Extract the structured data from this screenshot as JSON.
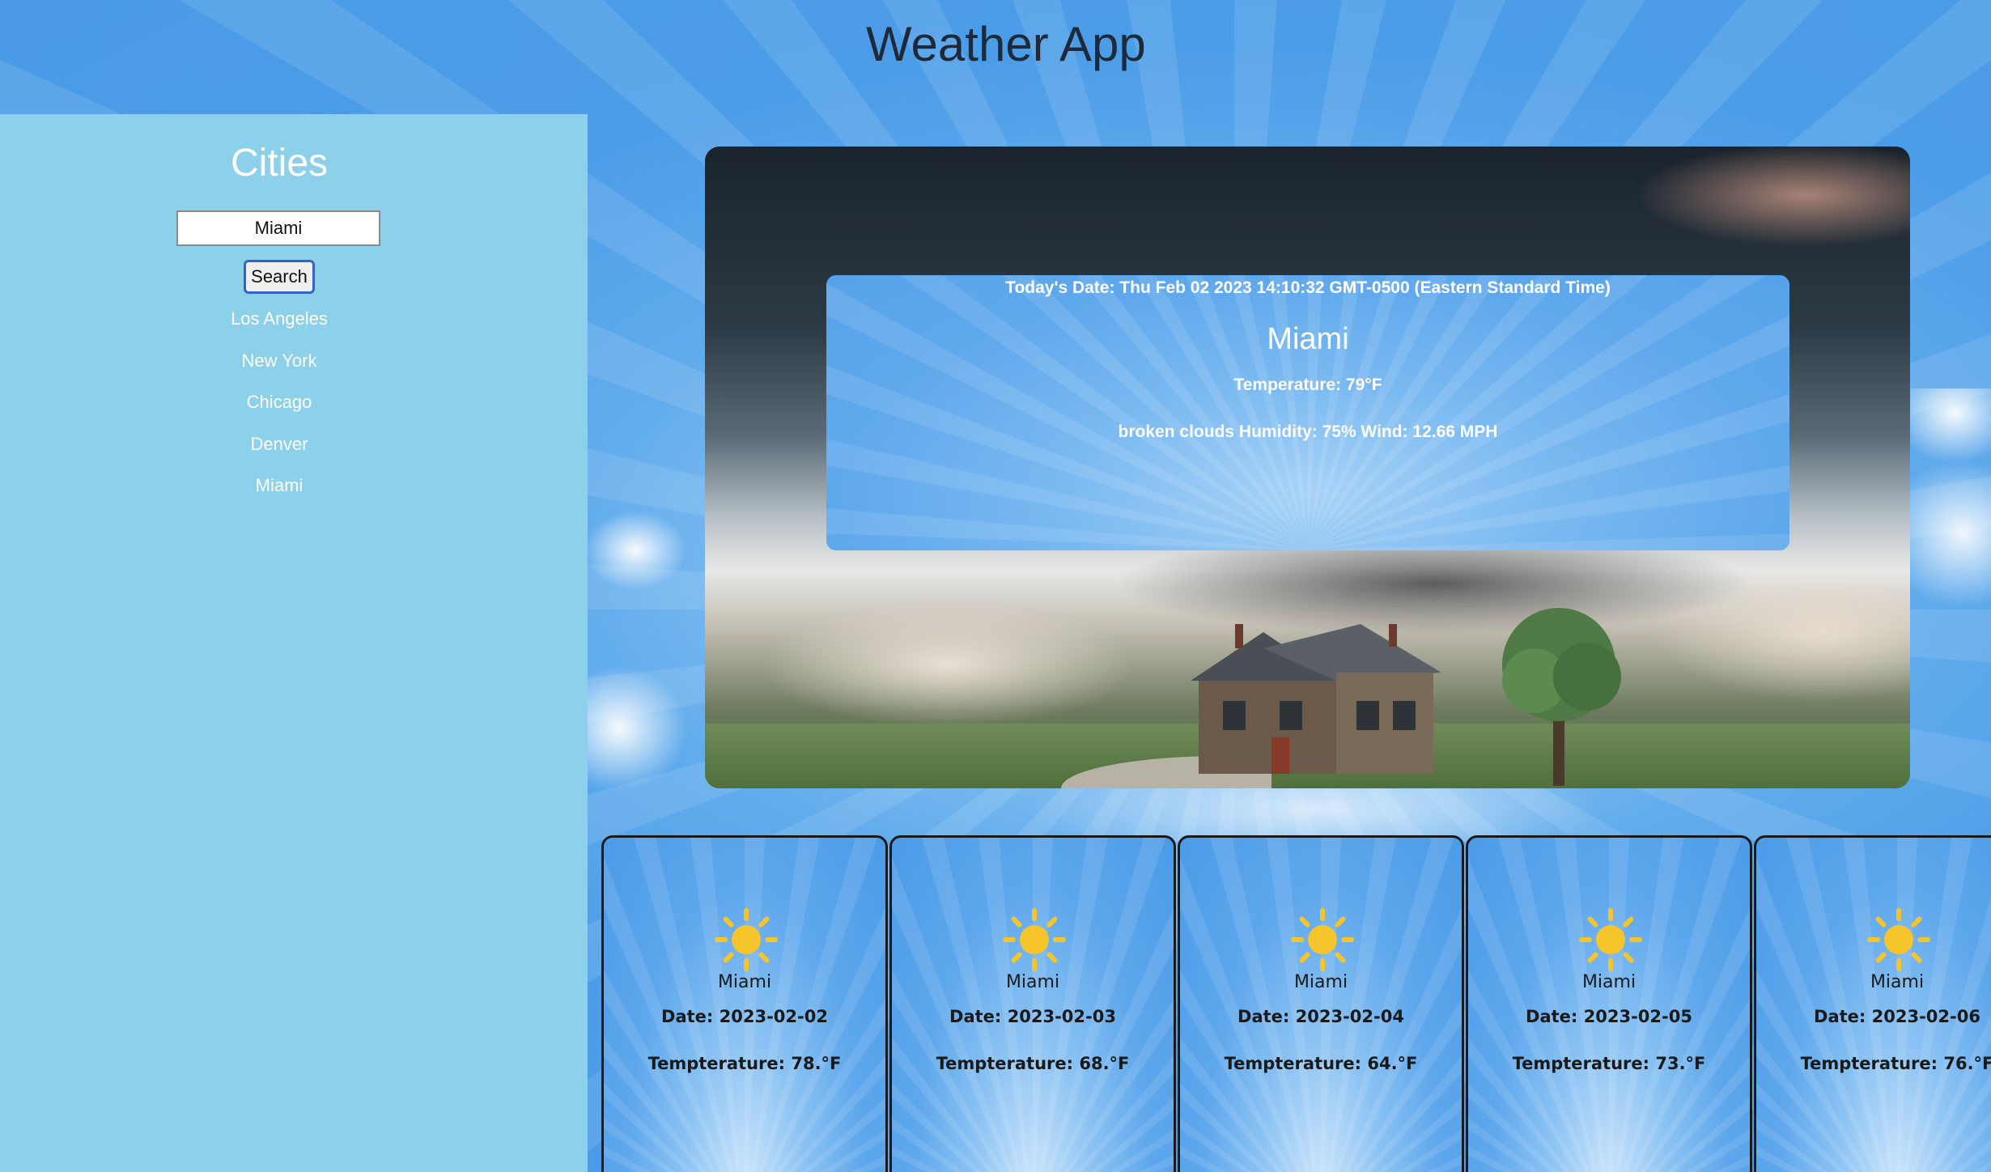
{
  "header": {
    "title": "Weather App"
  },
  "sidebar": {
    "title": "Cities",
    "search": {
      "value": "Miami",
      "button_label": "Search"
    },
    "cities": [
      {
        "label": "Los Angeles"
      },
      {
        "label": "New York"
      },
      {
        "label": "Chicago"
      },
      {
        "label": "Denver"
      },
      {
        "label": "Miami"
      }
    ]
  },
  "today": {
    "date_text": "Today's Date: Thu Feb 02 2023 14:10:32 GMT-0500 (Eastern Standard Time)",
    "city": "Miami",
    "temperature_text": "Temperature: 79°F",
    "details_text": "broken clouds Humidity: 75% Wind: 12.66 MPH"
  },
  "forecast": [
    {
      "icon": "sun-icon",
      "city": "Miami",
      "date_text": "Date: 2023-02-02",
      "temp_text": "Tempterature: 78.°F"
    },
    {
      "icon": "sun-icon",
      "city": "Miami",
      "date_text": "Date: 2023-02-03",
      "temp_text": "Tempterature: 68.°F"
    },
    {
      "icon": "sun-icon",
      "city": "Miami",
      "date_text": "Date: 2023-02-04",
      "temp_text": "Tempterature: 64.°F"
    },
    {
      "icon": "sun-icon",
      "city": "Miami",
      "date_text": "Date: 2023-02-05",
      "temp_text": "Tempterature: 73.°F"
    },
    {
      "icon": "sun-icon",
      "city": "Miami",
      "date_text": "Date: 2023-02-06",
      "temp_text": "Tempterature: 76.°F"
    }
  ],
  "colors": {
    "sidebar_bg": "#8cd0ea",
    "sky_blue": "#4a9ae6",
    "sun": "#f5c52b",
    "title_text": "#1e2a3a"
  }
}
